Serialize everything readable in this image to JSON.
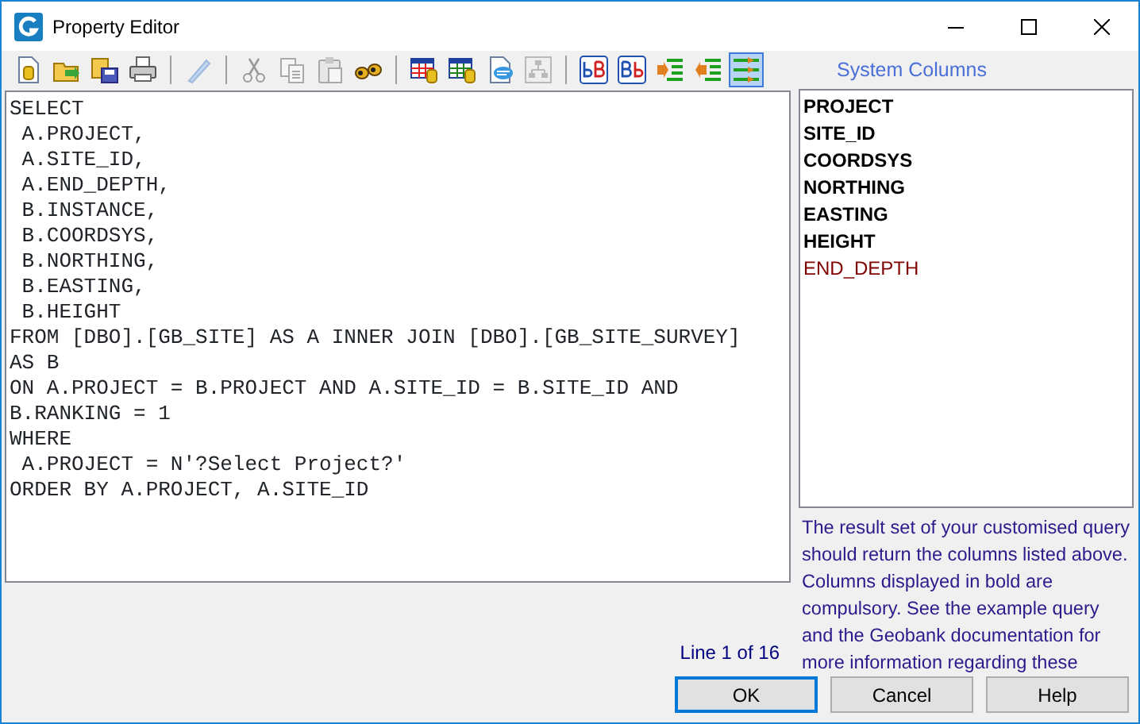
{
  "window": {
    "title": "Property Editor"
  },
  "toolbar": [
    {
      "kind": "new",
      "disabled": false,
      "selected": false
    },
    {
      "kind": "open",
      "disabled": false,
      "selected": false
    },
    {
      "kind": "save",
      "disabled": false,
      "selected": false
    },
    {
      "kind": "print",
      "disabled": false,
      "selected": false
    },
    {
      "kind": "separator"
    },
    {
      "kind": "pen",
      "disabled": true,
      "selected": false
    },
    {
      "kind": "separator"
    },
    {
      "kind": "cut",
      "disabled": true,
      "selected": false
    },
    {
      "kind": "copy",
      "disabled": true,
      "selected": false
    },
    {
      "kind": "paste",
      "disabled": true,
      "selected": false
    },
    {
      "kind": "find",
      "disabled": false,
      "selected": false
    },
    {
      "kind": "separator"
    },
    {
      "kind": "table-red",
      "disabled": false,
      "selected": false
    },
    {
      "kind": "table-green",
      "disabled": false,
      "selected": false
    },
    {
      "kind": "preview",
      "disabled": false,
      "selected": false
    },
    {
      "kind": "diagram",
      "disabled": true,
      "selected": false
    },
    {
      "kind": "separator"
    },
    {
      "kind": "lower-upper",
      "disabled": false,
      "selected": false
    },
    {
      "kind": "upper-lower",
      "disabled": false,
      "selected": false
    },
    {
      "kind": "indent",
      "disabled": false,
      "selected": false
    },
    {
      "kind": "outdent",
      "disabled": false,
      "selected": false
    },
    {
      "kind": "wrap",
      "disabled": false,
      "selected": true
    }
  ],
  "editor": {
    "lines": [
      "SELECT",
      " A.PROJECT,",
      " A.SITE_ID,",
      " A.END_DEPTH,",
      " B.INSTANCE,",
      " B.COORDSYS,",
      " B.NORTHING,",
      " B.EASTING,",
      " B.HEIGHT",
      "FROM [DBO].[GB_SITE] AS A INNER JOIN [DBO].[GB_SITE_SURVEY]",
      "AS B",
      "ON A.PROJECT = B.PROJECT AND A.SITE_ID = B.SITE_ID AND",
      "B.RANKING = 1",
      "WHERE",
      " A.PROJECT = N'?Select Project?'",
      "ORDER BY A.PROJECT, A.SITE_ID"
    ]
  },
  "system_columns": {
    "title": "System Columns",
    "items": [
      {
        "name": "PROJECT",
        "compulsory": true
      },
      {
        "name": "SITE_ID",
        "compulsory": true
      },
      {
        "name": "COORDSYS",
        "compulsory": true
      },
      {
        "name": "NORTHING",
        "compulsory": true
      },
      {
        "name": "EASTING",
        "compulsory": true
      },
      {
        "name": "HEIGHT",
        "compulsory": true
      },
      {
        "name": "END_DEPTH",
        "compulsory": false
      }
    ],
    "note": "The result set of your customised query should return the columns listed above. Columns displayed in bold are compulsory. See the example query and the Geobank documentation for more information regarding these"
  },
  "status": "Line 1 of 16",
  "buttons": [
    {
      "label": "OK",
      "default": true
    },
    {
      "label": "Cancel",
      "default": false
    },
    {
      "label": "Help",
      "default": false
    }
  ]
}
